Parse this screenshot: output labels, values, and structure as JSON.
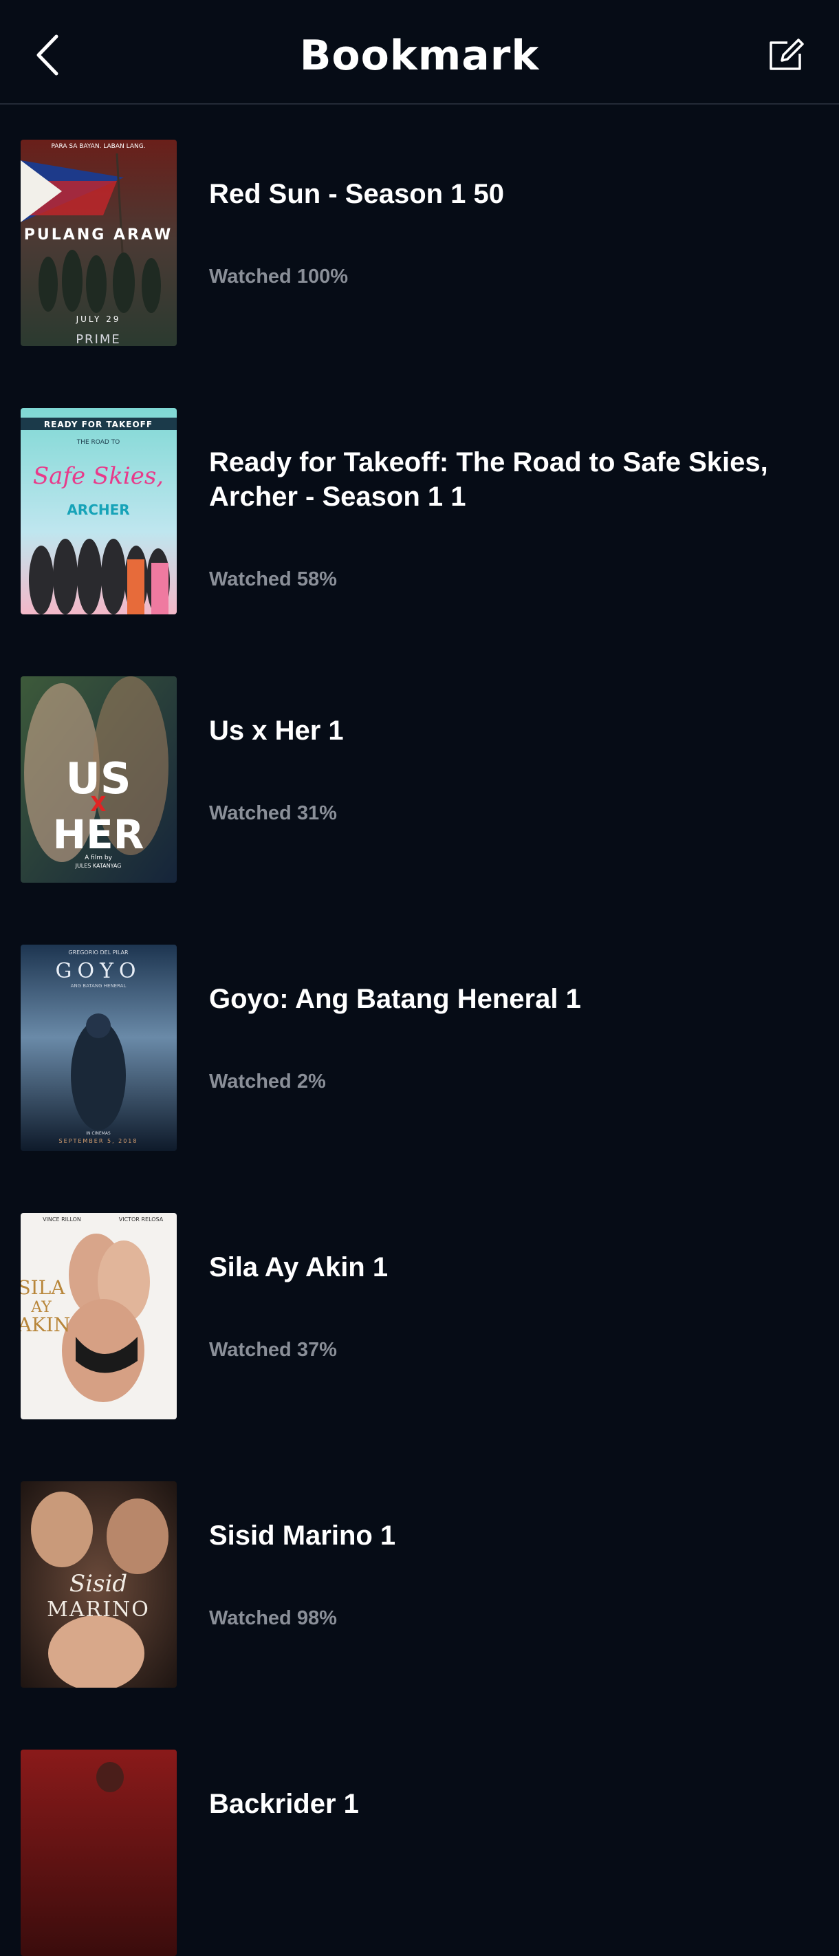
{
  "header": {
    "title": "Bookmark",
    "back_icon": "chevron-left-icon",
    "edit_icon": "edit-icon"
  },
  "items": [
    {
      "title": "Red Sun - Season 1 50",
      "progress": "Watched 100%",
      "poster_texts": [
        "PARA SA BAYAN. LABAN LANG.",
        "PULANG ARAW",
        "JULY 29",
        "PRIME"
      ],
      "poster_colors": [
        "#6a1f1a",
        "#2b3a30"
      ]
    },
    {
      "title": "Ready for Takeoff: The Road to Safe Skies, Archer - Season 1 1",
      "progress": "Watched 58%",
      "poster_texts": [
        "READY FOR TAKEOFF",
        "THE ROAD TO",
        "Safe Skies,",
        "ARCHER"
      ],
      "poster_colors": [
        "#7fd8d4",
        "#f3b8c8"
      ]
    },
    {
      "title": "Us x Her 1",
      "progress": "Watched 31%",
      "poster_texts": [
        "US",
        "X",
        "HER",
        "A film by",
        "JULES KATANYAG"
      ],
      "poster_colors": [
        "#2c4a3a",
        "#1a2a3e"
      ]
    },
    {
      "title": "Goyo: Ang Batang Heneral 1",
      "progress": "Watched 2%",
      "poster_texts": [
        "GREGORIO DEL PILAR",
        "GOYO",
        "ANG BATANG HENERAL",
        "IN CINEMAS",
        "SEPTEMBER 5, 2018"
      ],
      "poster_colors": [
        "#2a4a6a",
        "#0e1a2a"
      ]
    },
    {
      "title": "Sila Ay Akin 1",
      "progress": "Watched 37%",
      "poster_texts": [
        "VINCE RILLON",
        "VICTOR RELOSA",
        "SILA",
        "AY",
        "AKIN"
      ],
      "poster_colors": [
        "#f4f2ef",
        "#d9cfc6"
      ]
    },
    {
      "title": "Sisid Marino 1",
      "progress": "Watched 98%",
      "poster_texts": [
        "Sisid",
        "MARINO"
      ],
      "poster_colors": [
        "#4a2e22",
        "#1e1512"
      ]
    },
    {
      "title": "Backrider 1",
      "progress": "",
      "poster_texts": [],
      "poster_colors": [
        "#8a1a1a",
        "#3a0c0c"
      ]
    }
  ]
}
